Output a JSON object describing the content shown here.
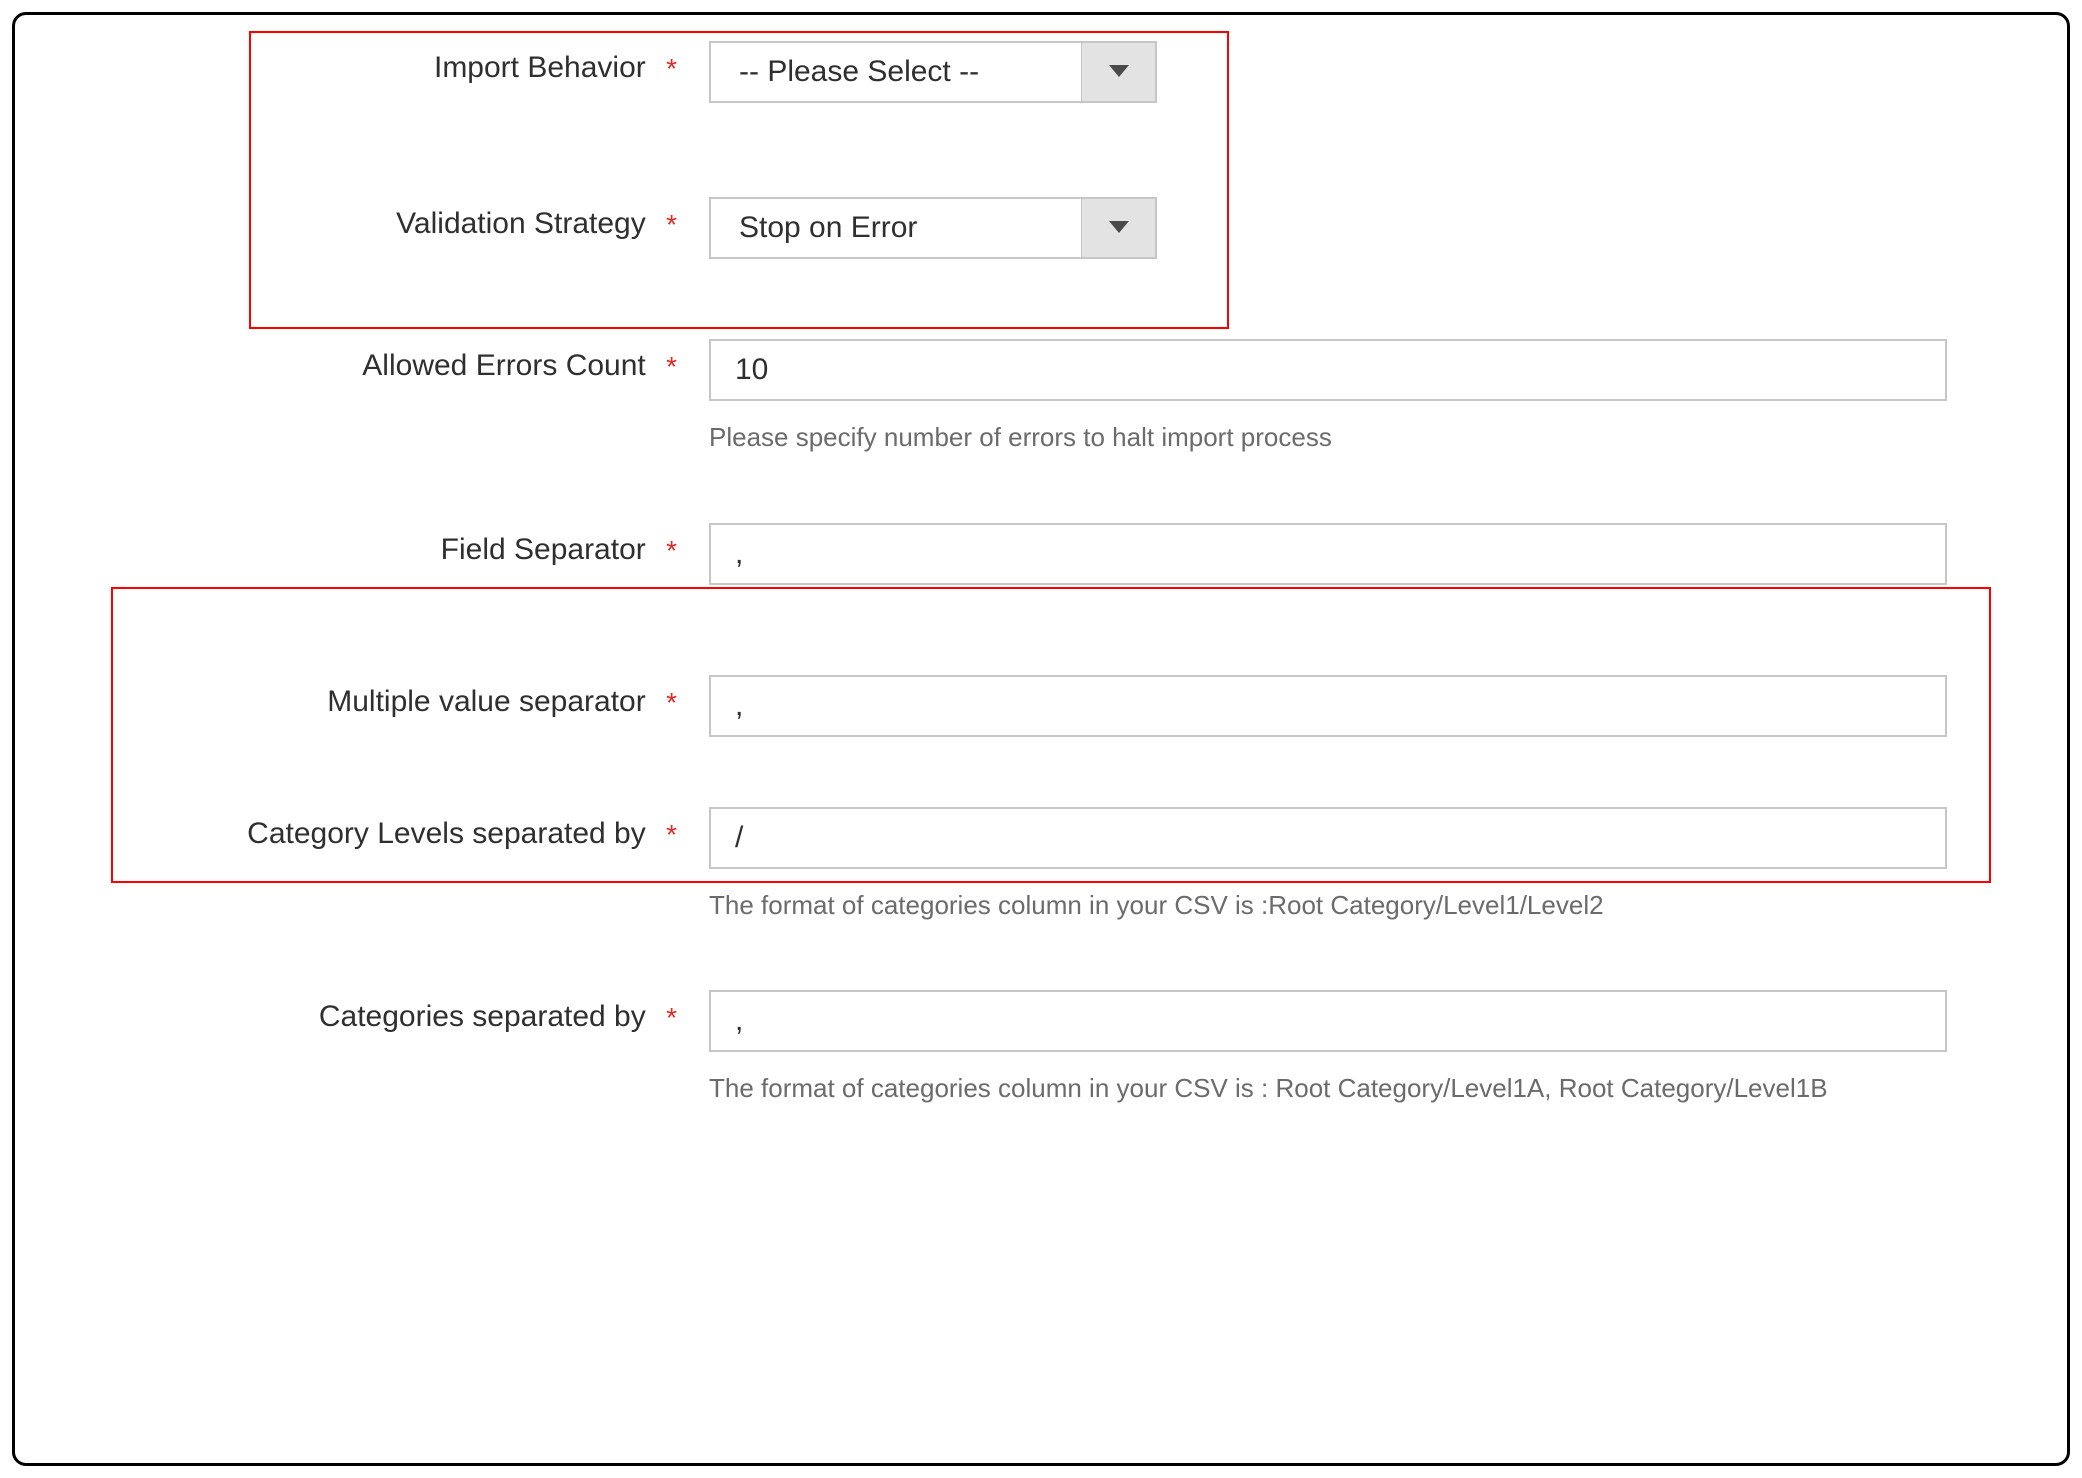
{
  "form": {
    "importBehavior": {
      "label": "Import Behavior",
      "value": "-- Please Select --"
    },
    "validationStrategy": {
      "label": "Validation Strategy",
      "value": "Stop on Error"
    },
    "allowedErrors": {
      "label": "Allowed Errors Count",
      "value": "10",
      "note": "Please specify number of errors to halt import process"
    },
    "fieldSeparator": {
      "label": "Field Separator",
      "value": ","
    },
    "multiValueSeparator": {
      "label": "Multiple value separator",
      "value": ","
    },
    "categoryLevels": {
      "label": "Category Levels separated by",
      "value": "/",
      "note": "The format of categories column in your CSV is :Root Category/Level1/Level2"
    },
    "categoriesSeparated": {
      "label": "Categories separated by",
      "value": ",",
      "note": "The format of categories column in your CSV is : Root Category/Level1A, Root Category/Level1B"
    },
    "requiredMark": "*"
  }
}
